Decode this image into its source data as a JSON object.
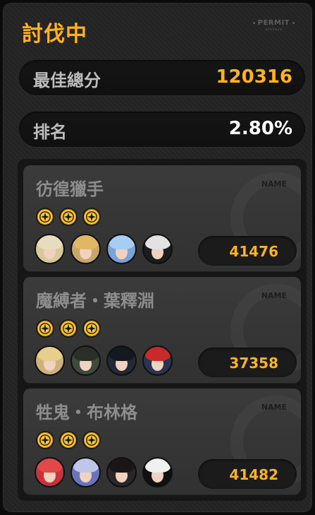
{
  "header": {
    "title": "討伐中",
    "permit_main": "PERMIT",
    "permit_sub": "xxxxxxx"
  },
  "stats": [
    {
      "label": "最佳總分",
      "value": "120316"
    },
    {
      "label": "排名",
      "value": "2.80%"
    }
  ],
  "teams": [
    {
      "name": "彷徨獵手",
      "tag": "NAME",
      "score": "41476",
      "medals": 3,
      "agents": [
        {
          "icon": "agent-1-icon",
          "bg": "#d9c89a",
          "hair": "#e8dcc0"
        },
        {
          "icon": "agent-2-icon",
          "bg": "#c9a76a",
          "hair": "#e0b865"
        },
        {
          "icon": "agent-3-icon",
          "bg": "#7aa4d8",
          "hair": "#a8cdf3"
        },
        {
          "icon": "agent-4-icon",
          "bg": "#1c1c1c",
          "hair": "#e2e2e2"
        }
      ]
    },
    {
      "name": "魔縛者・葉釋淵",
      "tag": "NAME",
      "score": "37358",
      "medals": 3,
      "agents": [
        {
          "icon": "agent-5-icon",
          "bg": "#cdb27a",
          "hair": "#e6cf8a"
        },
        {
          "icon": "agent-6-icon",
          "bg": "#3f4a3d",
          "hair": "#2a3028"
        },
        {
          "icon": "agent-7-icon",
          "bg": "#242a35",
          "hair": "#141820"
        },
        {
          "icon": "agent-8-icon",
          "bg": "#2a3350",
          "hair": "#c82a2a"
        }
      ]
    },
    {
      "name": "牲鬼・布林格",
      "tag": "NAME",
      "score": "41482",
      "medals": 3,
      "agents": [
        {
          "icon": "agent-9-icon",
          "bg": "#c8323a",
          "hair": "#e24848"
        },
        {
          "icon": "agent-10-icon",
          "bg": "#6a74b8",
          "hair": "#c0c6ea"
        },
        {
          "icon": "agent-11-icon",
          "bg": "#2b2628",
          "hair": "#1a1618"
        },
        {
          "icon": "agent-12-icon",
          "bg": "#111111",
          "hair": "#f0f0f0"
        }
      ]
    }
  ],
  "colors": {
    "accent": "#ffb21c",
    "medal": "#ffc62a"
  }
}
